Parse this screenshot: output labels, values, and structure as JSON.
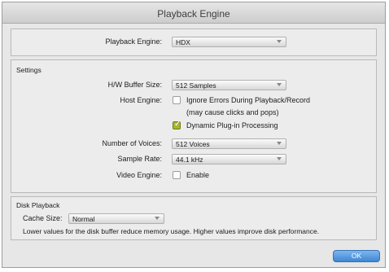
{
  "window": {
    "title": "Playback Engine"
  },
  "playback_engine": {
    "label": "Playback Engine:",
    "value": "HDX"
  },
  "settings": {
    "section_label": "Settings",
    "hw_buffer": {
      "label": "H/W Buffer Size:",
      "value": "512 Samples"
    },
    "host_engine": {
      "label": "Host Engine:",
      "ignore_errors_label": "Ignore Errors During Playback/Record",
      "ignore_errors_note": "(may cause clicks and pops)",
      "ignore_errors_checked": false,
      "dynamic_plugin_label": "Dynamic Plug-in Processing",
      "dynamic_plugin_checked": true
    },
    "voices": {
      "label": "Number of Voices:",
      "value": "512 Voices"
    },
    "sample_rate": {
      "label": "Sample Rate:",
      "value": "44.1 kHz"
    },
    "video_engine": {
      "label": "Video Engine:",
      "enable_label": "Enable",
      "checked": false
    }
  },
  "disk_playback": {
    "section_label": "Disk Playback",
    "cache_size": {
      "label": "Cache Size:",
      "value": "Normal"
    },
    "note": "Lower values for the disk buffer reduce memory usage.  Higher values improve disk performance."
  },
  "buttons": {
    "ok": "OK"
  },
  "colors": {
    "accent_check": "#a8b62b",
    "ok_button": "#4f93dc"
  }
}
